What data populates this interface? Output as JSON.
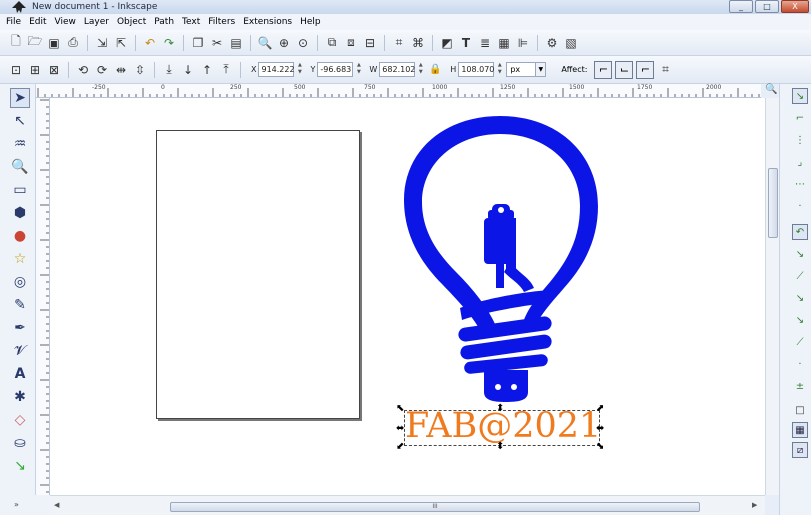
{
  "window": {
    "title": "New document 1 - Inkscape",
    "buttons": [
      "_",
      "□",
      "X"
    ]
  },
  "menu": [
    "File",
    "Edit",
    "View",
    "Layer",
    "Object",
    "Path",
    "Text",
    "Filters",
    "Extensions",
    "Help"
  ],
  "toolbar": {
    "x_label": "X",
    "x_value": "914.222",
    "y_label": "Y",
    "y_value": "-96.683",
    "w_label": "W",
    "w_value": "682.102",
    "h_label": "H",
    "h_value": "108.070",
    "unit": "px",
    "affect_label": "Affect:"
  },
  "ruler": {
    "h_labels": [
      "-250",
      "0",
      "250",
      "500",
      "750",
      "1000",
      "1250",
      "1500",
      "1750",
      "2000"
    ]
  },
  "canvas": {
    "text_object": "FAB@2021",
    "colors": {
      "bulb": "#0b16e6",
      "text": "#f07a1e"
    }
  },
  "statusbar": {
    "scroll_grip": "III",
    "left_chevrons": "»"
  }
}
